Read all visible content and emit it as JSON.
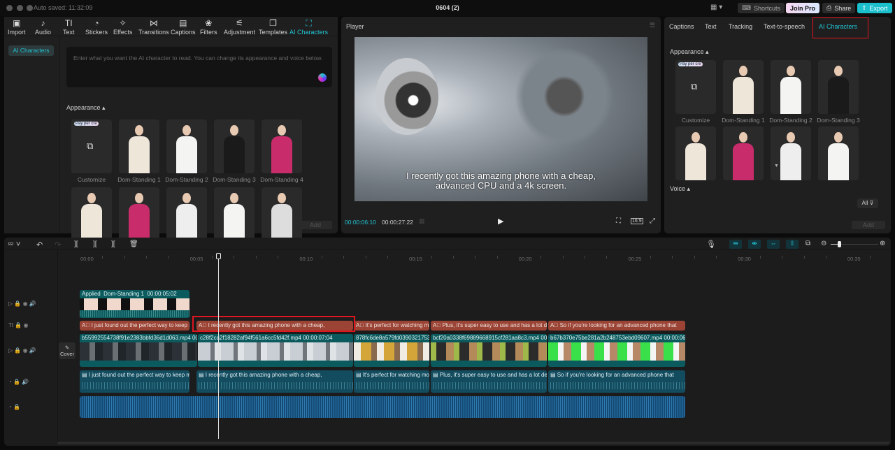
{
  "titlebar": {
    "autosave": "Auto saved: 11:32:09",
    "title": "0604 (2)",
    "shortcuts": "Shortcuts",
    "join_pro": "Join Pro",
    "share": "Share",
    "export": "Export"
  },
  "toolbar": [
    {
      "label": "Import",
      "icon": "import-icon",
      "glyph": "▣"
    },
    {
      "label": "Audio",
      "icon": "audio-icon",
      "glyph": "♪"
    },
    {
      "label": "Text",
      "icon": "text-icon",
      "glyph": "TI"
    },
    {
      "label": "Stickers",
      "icon": "sticker-icon",
      "glyph": "◔"
    },
    {
      "label": "Effects",
      "icon": "effects-icon",
      "glyph": "✧"
    },
    {
      "label": "Transitions",
      "icon": "transitions-icon",
      "glyph": "⋈"
    },
    {
      "label": "Captions",
      "icon": "captions-icon",
      "glyph": "▤"
    },
    {
      "label": "Filters",
      "icon": "filters-icon",
      "glyph": "❀"
    },
    {
      "label": "Adjustment",
      "icon": "adjustment-icon",
      "glyph": "⚟"
    },
    {
      "label": "Templates",
      "icon": "templates-icon",
      "glyph": "❒"
    },
    {
      "label": "AI Characters",
      "icon": "ai-characters-icon",
      "glyph": "⛶"
    }
  ],
  "left": {
    "sidebar_item": "AI Characters",
    "placeholder": "Enter what you want the AI character to read. You can change its appearance and voice below.",
    "appearance": "Appearance",
    "badge": "Pay per cre",
    "add": "Add",
    "avatars": [
      "Customize",
      "Dom-Standing 1",
      "Dom-Standing 2",
      "Dom-Standing 3",
      "Dom-Standing 4"
    ]
  },
  "player": {
    "title": "Player",
    "subtitle_line1": "I recently got this amazing phone with a cheap,",
    "subtitle_line2": "advanced CPU and a 4k screen.",
    "current": "00:00:06:10",
    "total": "00:00:27:22",
    "ratio": "16:9"
  },
  "right": {
    "tabs": [
      "Captions",
      "Text",
      "Tracking",
      "Text-to-speech",
      "AI Characters"
    ],
    "active_tab": "AI Characters",
    "appearance": "Appearance",
    "badge": "Pay per cre",
    "avatars": [
      "Customize",
      "Dom-Standing 1",
      "Dom-Standing 2",
      "Dom-Standing 3"
    ],
    "voice": "Voice",
    "filter": "All",
    "add": "Add"
  },
  "timeline": {
    "cover": "Cover",
    "ticks": [
      "00:00",
      "00:05",
      "00:10",
      "00:15",
      "00:20",
      "00:25",
      "00:30",
      "00:35"
    ],
    "playhead_time": "00:00:06:10",
    "avatar_clip": {
      "applied": "Applied",
      "name": "Dom-Standing 1",
      "duration": "00:00:05:02"
    },
    "text_clips": [
      "I just found out the perfect way to keep m",
      "I recently got this amazing phone with a cheap,",
      "It's perfect for watching mo",
      "Plus, it's super easy to use and has a lot de",
      "So if you're looking for an advanced phone that"
    ],
    "video_clips": [
      {
        "name": "b55992554738f91e2383bbfd36d1d063.mp4",
        "dur": "00"
      },
      {
        "name": "c28f2ca2f18282af94f561a6cc5fd42f.mp4",
        "dur": "00:00:07:04"
      },
      {
        "name": "878fc6de8a579fd039032175340",
        "dur": ""
      },
      {
        "name": "bcf20a0338f69889668915cf281aa8c3.mp4",
        "dur": "00:"
      },
      {
        "name": "b67b370e75be281a2b248753ebd09607.mp4",
        "dur": "00:00:06:1"
      }
    ],
    "caption_clips": [
      "I just found out the perfect way to keep me",
      "I recently got this amazing phone with a cheap,",
      "It's perfect for watching mov",
      "Plus, it's super easy to use and has a lot de",
      "So if you're looking for an advanced phone that"
    ]
  },
  "colors": {
    "accent": "#22c3d0",
    "selection": "#e0161e",
    "text_clip": "#9b4334",
    "video_clip": "#0b5a5e"
  }
}
